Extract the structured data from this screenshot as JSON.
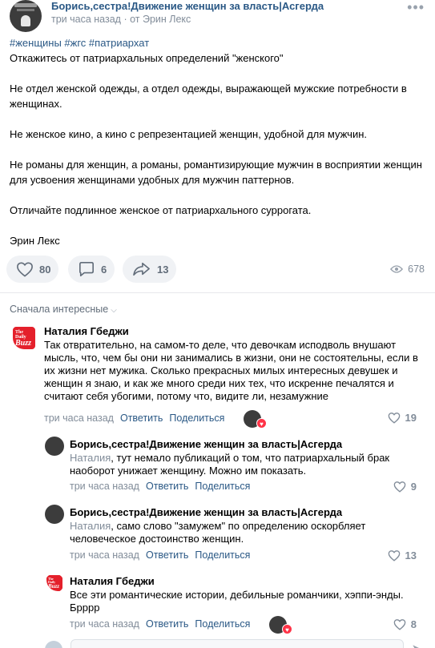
{
  "post": {
    "group_name": "Борись,сестра!Движение женщин за власть|Асгерда",
    "time": "три часа назад",
    "by_prefix": "· от",
    "author": "Эрин Лекс",
    "more": "•••",
    "tags": "#женщины #жгс #патриархат",
    "lines": [
      "Откажитесь от патриархальных определений \"женского\"",
      "Не отдел женской одежды, а отдел одежды, выражающей мужские потребности в женщинах.",
      "Не женское кино, а кино с репрезентацией женщин, удобной для мужчин.",
      "Не романы для женщин, а романы, романтизирующие мужчин в восприятии женщин для усвоения женщинами удобных для мужчин паттернов.",
      "Отличайте подлинное женское от патриархального суррогата.",
      "Эрин Лекс"
    ],
    "likes": "80",
    "comments": "6",
    "shares": "13",
    "views": "678"
  },
  "sort": {
    "label": "Сначала интересные",
    "chevron": "⌵"
  },
  "comments": [
    {
      "name": "Наталия Гбеджи",
      "reply_to": "",
      "text": "Так отвратительно, на самом-то деле, что девочкам исподволь внушают мысль, что, чем бы они ни занимались в жизни, они не состоятельны, если в их жизни нет мужика. Сколько прекрасных милых интересных девушек и женщин я знаю, и как же много среди них тех, что искренне печалятся и считают себя убогими, потому что, видите ли, незамужние",
      "time": "три часа назад",
      "reply": "Ответить",
      "share": "Поделиться",
      "likes": "19"
    },
    {
      "name": "Борись,сестра!Движение женщин за власть|Асгерда",
      "reply_to": "Наталия",
      "text": ", тут немало публикаций о том, что патриархальный брак наоборот унижает женщину. Можно им показать.",
      "time": "три часа назад",
      "reply": "Ответить",
      "share": "Поделиться",
      "likes": "9"
    },
    {
      "name": "Борись,сестра!Движение женщин за власть|Асгерда",
      "reply_to": "Наталия",
      "text": ", само слово \"замужем\" по определению оскорбляет человеческое достоинство женщин.",
      "time": "три часа назад",
      "reply": "Ответить",
      "share": "Поделиться",
      "likes": "13"
    },
    {
      "name": "Наталия Гбеджи",
      "reply_to": "",
      "text": "Все эти романтические истории, дебильные романчики, хэппи-энды. Брррр",
      "time": "три часа назад",
      "reply": "Ответить",
      "share": "Поделиться",
      "likes": "8"
    }
  ],
  "avatar_logo": {
    "line1": "The",
    "line2": "Daily",
    "line3": "Buzz"
  },
  "colors": {
    "link": "#2a5885",
    "muted": "#818c99",
    "accent_red": "#ff3347"
  }
}
